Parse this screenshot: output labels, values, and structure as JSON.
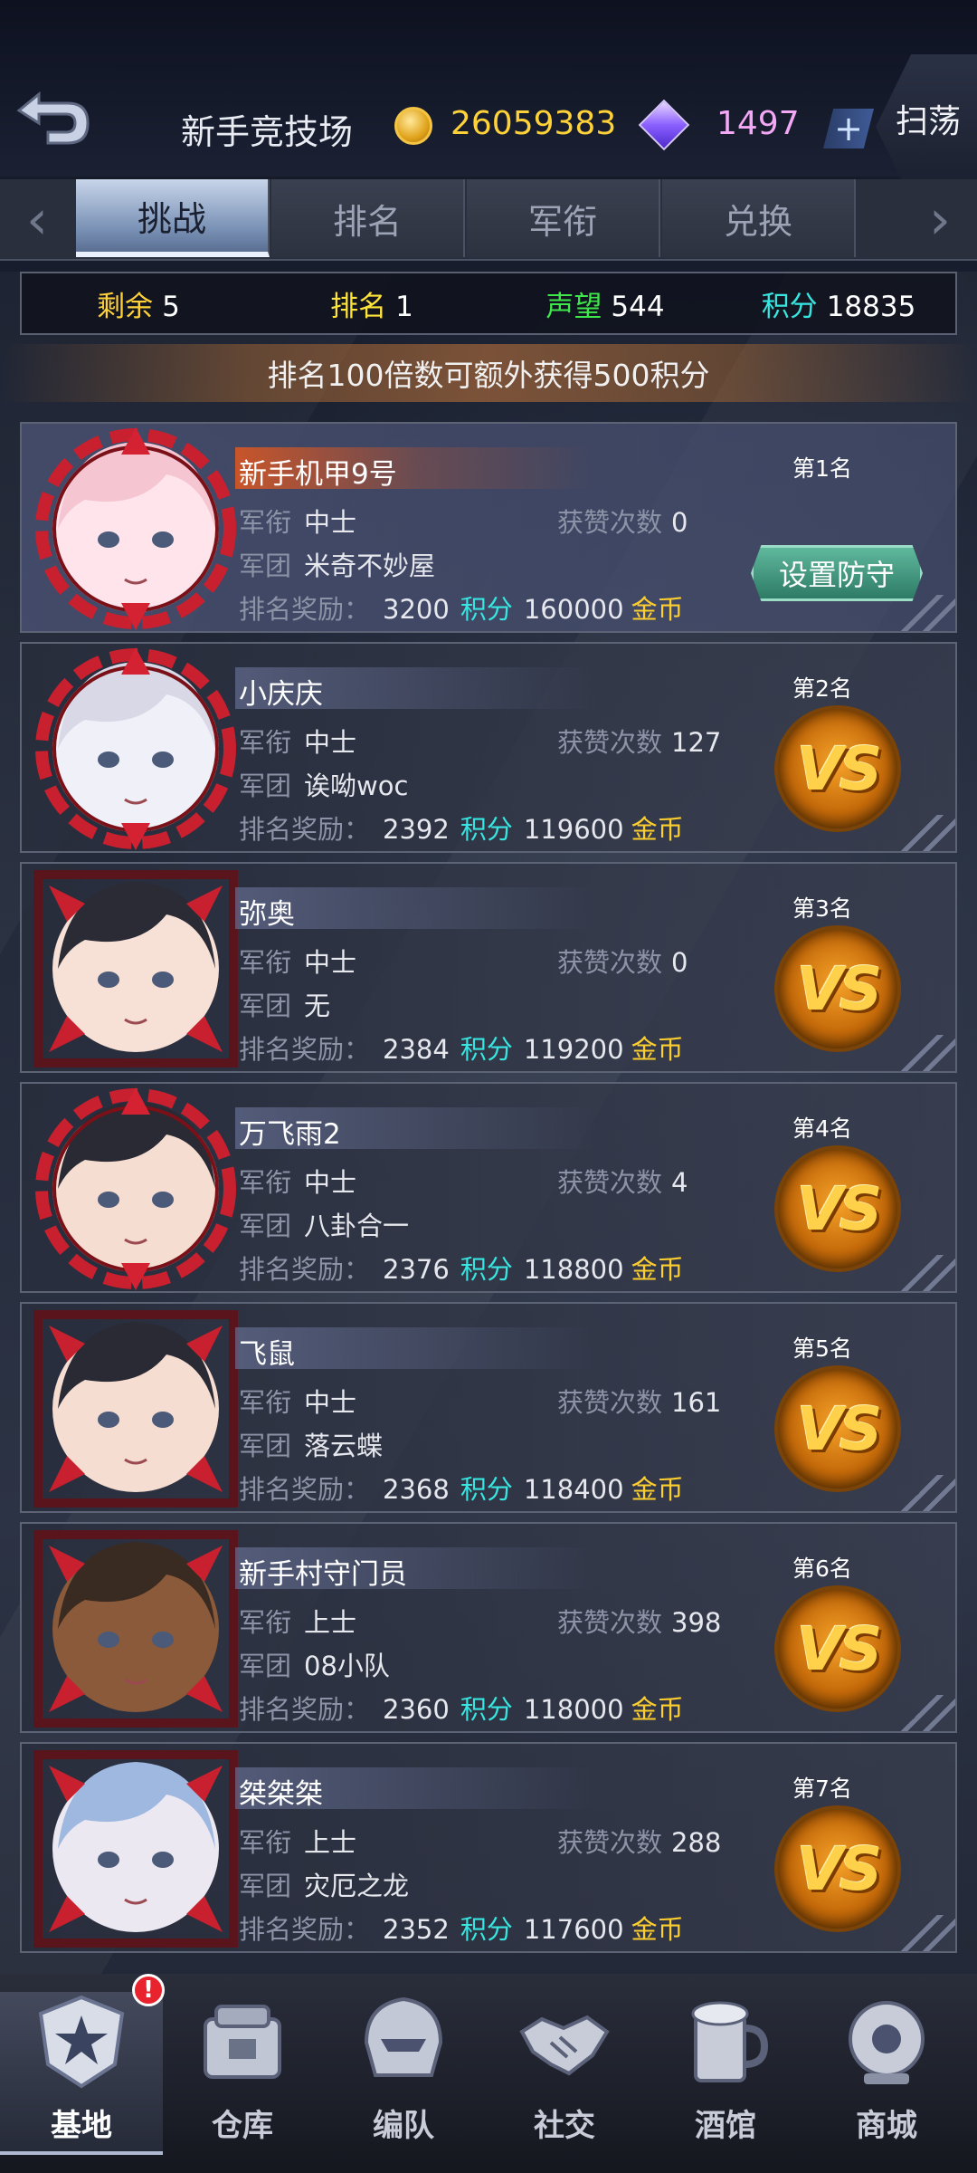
{
  "header": {
    "title": "新手竞技场",
    "gold": "26059383",
    "gems": "1497",
    "plus_label": "+",
    "sweep_label": "扫荡"
  },
  "tabs": [
    {
      "label": "挑战",
      "active": true
    },
    {
      "label": "排名",
      "active": false
    },
    {
      "label": "军衔",
      "active": false
    },
    {
      "label": "兑换",
      "active": false
    }
  ],
  "stats": {
    "remaining_label": "剩余",
    "remaining": "5",
    "rank_label": "排名",
    "rank": "1",
    "prestige_label": "声望",
    "prestige": "544",
    "points_label": "积分",
    "points": "18835",
    "colors": {
      "remaining": "#ffd23a",
      "rank": "#ffe43a",
      "prestige": "#3ee84a",
      "points": "#38e5e0"
    }
  },
  "notice": "排名100倍数可额外获得500积分",
  "labels": {
    "rank_title": "军衔",
    "legion": "军团",
    "likes": "获赞次数",
    "reward": "排名奖励：",
    "points_unit": "积分",
    "gold_unit": "金币",
    "set_defense": "设置防守",
    "vs": "VS"
  },
  "players": [
    {
      "name": "新手机甲9号",
      "rank_title": "中士",
      "legion": "米奇不妙屋",
      "likes": "0",
      "reward_points": "3200",
      "reward_gold": "160000",
      "place": "第1名",
      "self": true
    },
    {
      "name": "小庆庆",
      "rank_title": "中士",
      "legion": "诶呦woc",
      "likes": "127",
      "reward_points": "2392",
      "reward_gold": "119600",
      "place": "第2名",
      "self": false
    },
    {
      "name": "弥奥",
      "rank_title": "中士",
      "legion": "无",
      "likes": "0",
      "reward_points": "2384",
      "reward_gold": "119200",
      "place": "第3名",
      "self": false
    },
    {
      "name": "万飞雨2",
      "rank_title": "中士",
      "legion": "八卦合一",
      "likes": "4",
      "reward_points": "2376",
      "reward_gold": "118800",
      "place": "第4名",
      "self": false
    },
    {
      "name": "飞鼠",
      "rank_title": "中士",
      "legion": "落云蝶",
      "likes": "161",
      "reward_points": "2368",
      "reward_gold": "118400",
      "place": "第5名",
      "self": false
    },
    {
      "name": "新手村守门员",
      "rank_title": "上士",
      "legion": "08小队",
      "likes": "398",
      "reward_points": "2360",
      "reward_gold": "118000",
      "place": "第6名",
      "self": false
    },
    {
      "name": "桀桀桀",
      "rank_title": "上士",
      "legion": "灾厄之龙",
      "likes": "288",
      "reward_points": "2352",
      "reward_gold": "117600",
      "place": "第7名",
      "self": false
    }
  ],
  "nav": [
    {
      "label": "基地",
      "icon": "base-star-icon",
      "active": true
    },
    {
      "label": "仓库",
      "icon": "warehouse-icon",
      "active": false
    },
    {
      "label": "编队",
      "icon": "mech-helmet-icon",
      "active": false
    },
    {
      "label": "社交",
      "icon": "handshake-icon",
      "active": false
    },
    {
      "label": "酒馆",
      "icon": "beer-mug-icon",
      "active": false
    },
    {
      "label": "商城",
      "icon": "shop-robot-icon",
      "active": false
    }
  ],
  "notification_badge": "!"
}
